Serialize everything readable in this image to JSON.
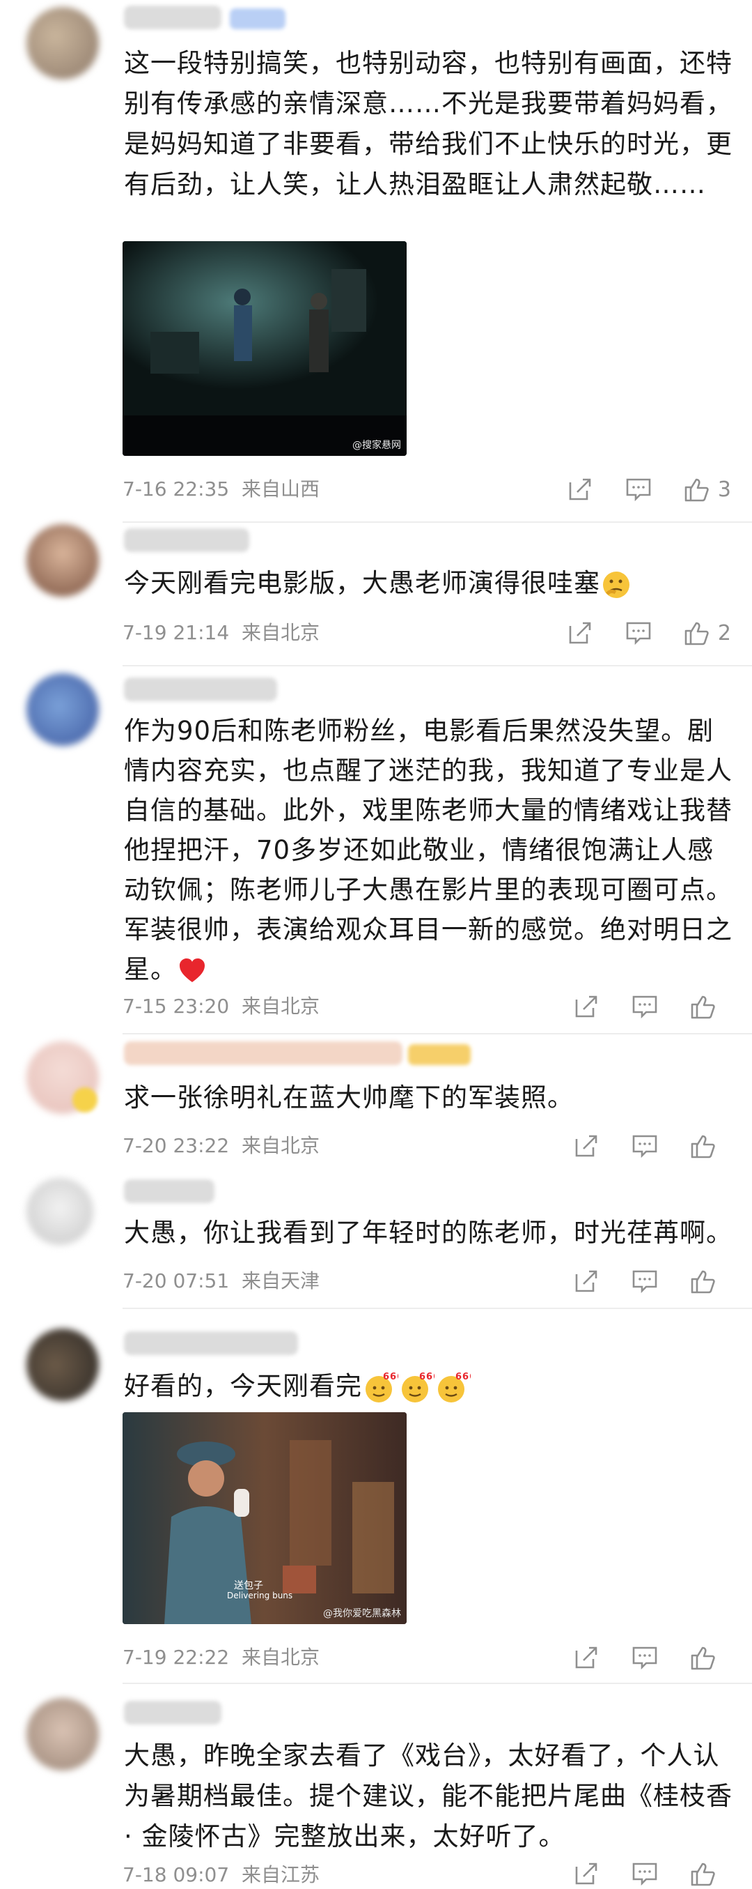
{
  "comments": [
    {
      "text": "这一段特别搞笑，也特别动容，也特别有画面，还特别有传承感的亲情深意……不光是我要带着妈妈看，是妈妈知道了非要看，带给我们不止快乐的时光，更有后劲，让人笑，让人热泪盈眶让人肃然起敬……",
      "time": "7-16 22:35",
      "location": "来自山西",
      "likes": "3",
      "image_watermark": "@搜家悬网"
    },
    {
      "text": "今天刚看完电影版，大愚老师演得很哇塞",
      "time": "7-19 21:14",
      "location": "来自北京",
      "likes": "2"
    },
    {
      "text": "作为90后和陈老师粉丝，电影看后果然没失望。剧情内容充实，也点醒了迷茫的我，我知道了专业是人自信的基础。此外，戏里陈老师大量的情绪戏让我替他捏把汗，70多岁还如此敬业，情绪很饱满让人感动钦佩；陈老师儿子大愚在影片里的表现可圈可点。军装很帅，表演给观众耳目一新的感觉。绝对明日之星。",
      "time": "7-15 23:20",
      "location": "来自北京",
      "likes": ""
    },
    {
      "text": "求一张徐明礼在蓝大帅麾下的军装照。",
      "time": "7-20 23:22",
      "location": "来自北京",
      "likes": ""
    },
    {
      "text": "大愚，你让我看到了年轻时的陈老师，时光荏苒啊。",
      "time": "7-20 07:51",
      "location": "来自天津",
      "likes": ""
    },
    {
      "text": "好看的，今天刚看完",
      "time": "7-19 22:22",
      "location": "来自北京",
      "likes": "",
      "subtitle_cn": "送包子",
      "subtitle_en": "Delivering buns",
      "image_watermark": "@我你爱吃黑森林"
    },
    {
      "text": "大愚，昨晚全家去看了《戏台》，太好看了，个人认为暑期档最佳。提个建议，能不能把片尾曲《桂枝香 · 金陵怀古》完整放出来，太好听了。",
      "time": "7-18 09:07",
      "location": "来自江苏",
      "likes": ""
    }
  ],
  "icons": [
    "share-icon",
    "comment-icon",
    "like-icon",
    "heart-emoji",
    "thinking-emoji",
    "666-emoji"
  ],
  "colors": {
    "text": "#1a1a1a",
    "meta": "#8f8f8f",
    "divider": "#ededed",
    "heart": "#e8262d",
    "emoji": "#f7b731"
  }
}
